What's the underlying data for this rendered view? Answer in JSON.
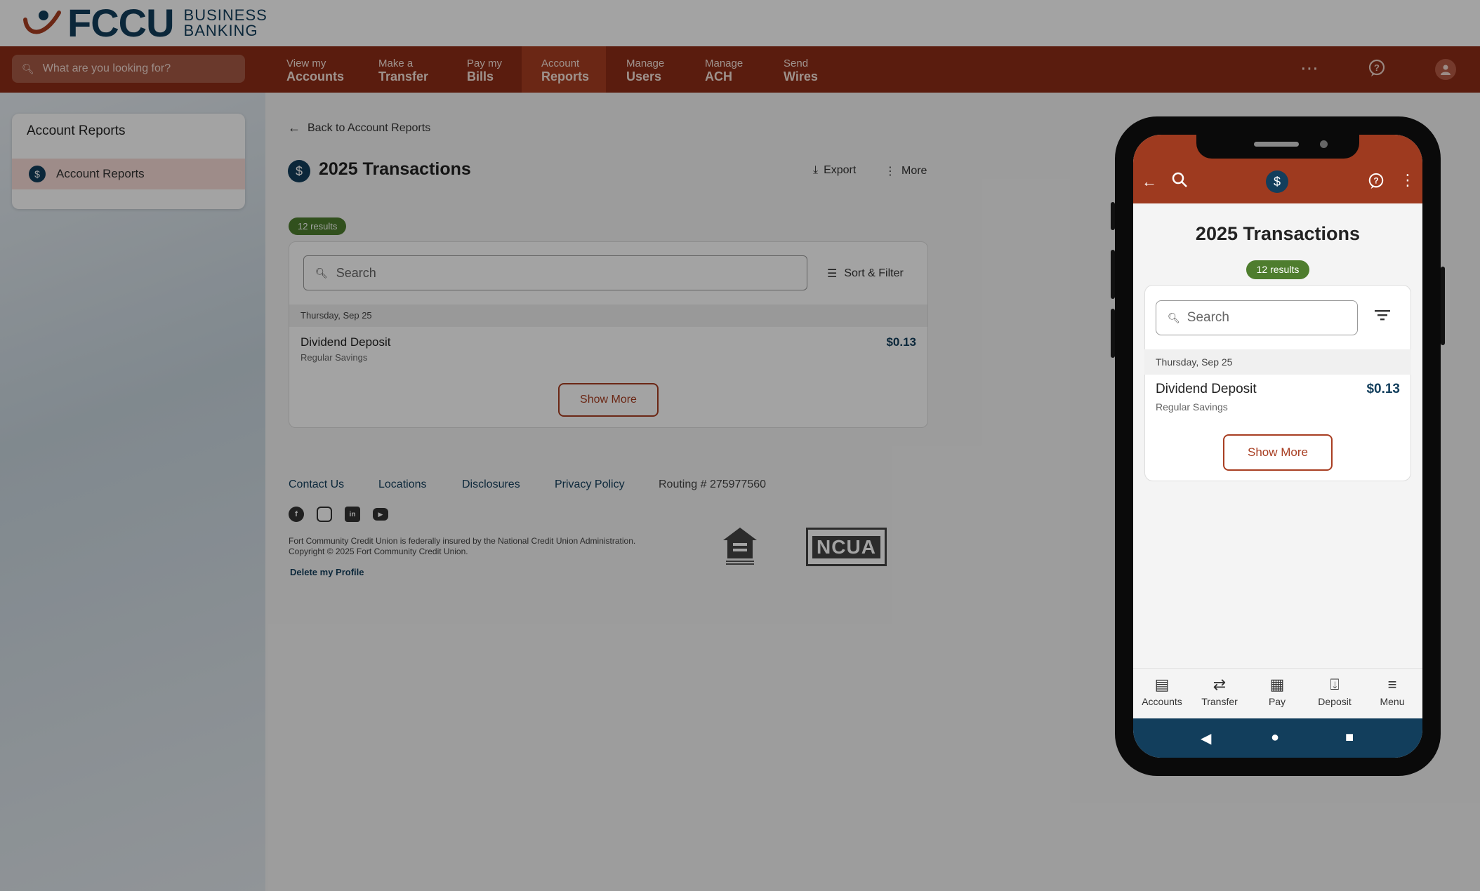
{
  "brand": {
    "name": "FCCU",
    "subline1": "BUSINESS",
    "subline2": "BANKING",
    "colors": {
      "primary": "#123e5c",
      "nav": "#8e2d16",
      "accent": "#a83e22",
      "badge": "#4e7d2e"
    }
  },
  "nav": {
    "search_placeholder": "What are you looking for?",
    "items": [
      {
        "l1": "View my",
        "l2": "Accounts"
      },
      {
        "l1": "Make a",
        "l2": "Transfer"
      },
      {
        "l1": "Pay my",
        "l2": "Bills"
      },
      {
        "l1": "Account",
        "l2": "Reports"
      },
      {
        "l1": "Manage",
        "l2": "Users"
      },
      {
        "l1": "Manage",
        "l2": "ACH"
      },
      {
        "l1": "Send",
        "l2": "Wires"
      }
    ],
    "more_icon": "⋯",
    "help_icon": "?",
    "profile_icon": "user"
  },
  "sidebar": {
    "title": "Account Reports",
    "items": [
      {
        "label": "Account Reports",
        "icon": "$"
      }
    ]
  },
  "main": {
    "back_label": "Back to Account Reports",
    "title": "2025 Transactions",
    "export_label": "Export",
    "more_label": "More",
    "results": "12 results",
    "search_placeholder": "Search",
    "sort_filter_label": "Sort & Filter",
    "date_header": "Thursday, Sep 25",
    "transactions": [
      {
        "description": "Dividend Deposit",
        "account": "Regular Savings",
        "amount": "$0.13"
      }
    ],
    "show_more_label": "Show More"
  },
  "footer": {
    "links": [
      "Contact Us",
      "Locations",
      "Disclosures",
      "Privacy Policy"
    ],
    "routing": "Routing # 275977560",
    "social": [
      "facebook",
      "instagram",
      "linkedin",
      "youtube"
    ],
    "legal1": "Fort Community Credit Union is federally insured by the National Credit Union Administration.",
    "legal2": "Copyright © 2025 Fort Community Credit Union.",
    "delete_profile": "Delete my Profile",
    "ncua_label": "NCUA"
  },
  "mobile": {
    "title": "2025 Transactions",
    "results": "12 results",
    "search_placeholder": "Search",
    "date_header": "Thursday, Sep 25",
    "transaction": {
      "description": "Dividend Deposit",
      "account": "Regular Savings",
      "amount": "$0.13"
    },
    "show_more_label": "Show More",
    "tabs": [
      "Accounts",
      "Transfer",
      "Pay",
      "Deposit",
      "Menu"
    ]
  }
}
